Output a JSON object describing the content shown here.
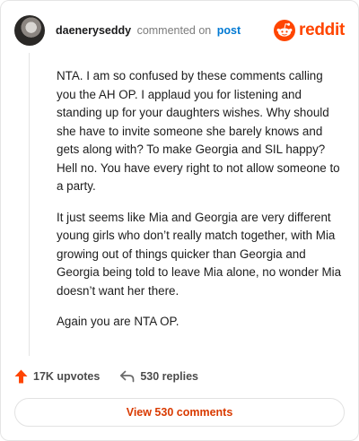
{
  "header": {
    "username": "daeneryseddy",
    "action": "commented on",
    "post_link": "post",
    "brand": "reddit",
    "brand_color": "#ff4500"
  },
  "comment": {
    "paragraphs": [
      "NTA. I am so confused by these comments calling you the AH OP. I applaud you for listening and standing up for your daughters wishes. Why should she have to invite someone she barely knows and gets along with? To make Georgia and SIL happy? Hell no. You have every right to not allow someone to a party.",
      "It just seems like Mia and Georgia are very different young girls who don’t really match together, with Mia growing out of things quicker than Georgia and Georgia being told to leave Mia alone, no wonder Mia doesn’t want her there.",
      "Again you are NTA OP."
    ]
  },
  "footer": {
    "upvotes": "17K upvotes",
    "replies": "530 replies",
    "view_button": "View 530 comments"
  },
  "icons": {
    "upvote": "upvote-arrow-icon",
    "reply": "reply-arrow-icon",
    "logo": "reddit-snoo-icon"
  }
}
